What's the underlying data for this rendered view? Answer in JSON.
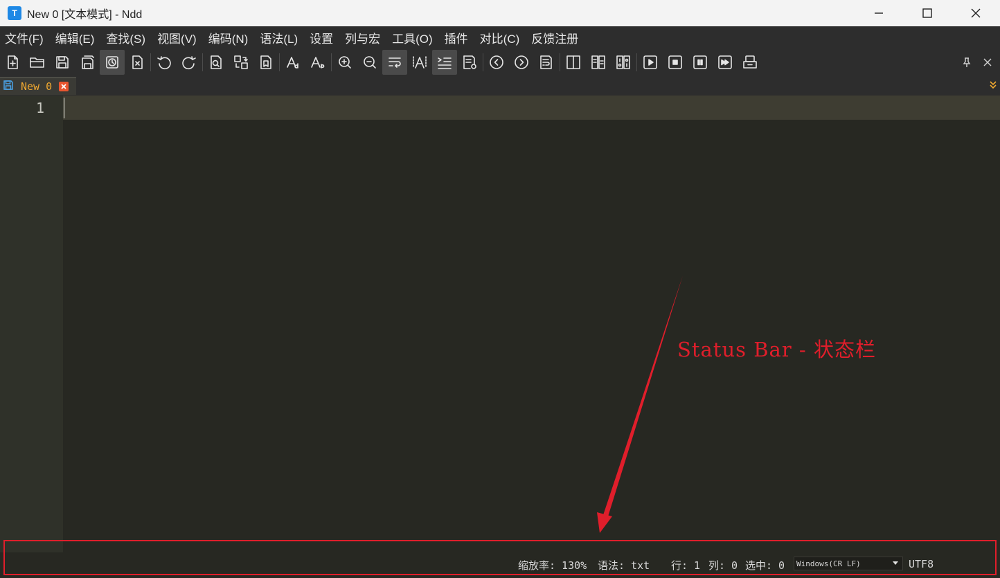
{
  "window": {
    "title": "New 0 [文本模式] - Ndd",
    "app_icon_letter": "T"
  },
  "menu": {
    "items": [
      {
        "label": "文件(F)"
      },
      {
        "label": "编辑(E)"
      },
      {
        "label": "查找(S)"
      },
      {
        "label": "视图(V)"
      },
      {
        "label": "编码(N)"
      },
      {
        "label": "语法(L)"
      },
      {
        "label": "设置"
      },
      {
        "label": "列与宏"
      },
      {
        "label": "工具(O)"
      },
      {
        "label": "插件"
      },
      {
        "label": "对比(C)"
      },
      {
        "label": "反馈注册"
      }
    ]
  },
  "toolbar": {
    "icons": [
      "new-file-icon",
      "open-folder-icon",
      "save-icon",
      "save-all-icon",
      "history-icon",
      "close-file-icon",
      "undo-icon",
      "redo-icon",
      "find-icon",
      "replace-icon",
      "bookmark-icon",
      "font-larger-icon",
      "font-smaller-icon",
      "zoom-in-icon",
      "zoom-out-icon",
      "word-wrap-icon",
      "show-symbols-icon",
      "indent-guide-icon",
      "doc-preview-icon",
      "prev-icon",
      "next-icon",
      "wrap-lines-icon",
      "split-view-icon",
      "compare-icon",
      "binary-icon",
      "play-macro-icon",
      "stop-macro-icon",
      "pause-macro-icon",
      "fast-forward-macro-icon",
      "save-macro-icon"
    ]
  },
  "tabs": [
    {
      "label": "New 0",
      "active": true
    }
  ],
  "editor": {
    "line_numbers": [
      "1"
    ],
    "content": ""
  },
  "status": {
    "zoom": "缩放率: 130%",
    "syntax": "语法: txt",
    "line": "行: 1",
    "column": "列: 0",
    "selection": "选中: 0",
    "eol": "Windows(CR LF)",
    "encoding": "UTF8"
  },
  "annotation": {
    "text": "Status Bar - 状态栏",
    "color": "#e01e2b"
  },
  "colors": {
    "editor_bg": "#272822",
    "current_line": "#3e3d32",
    "tab_label": "#f0a830",
    "annotation": "#e01e2b"
  }
}
